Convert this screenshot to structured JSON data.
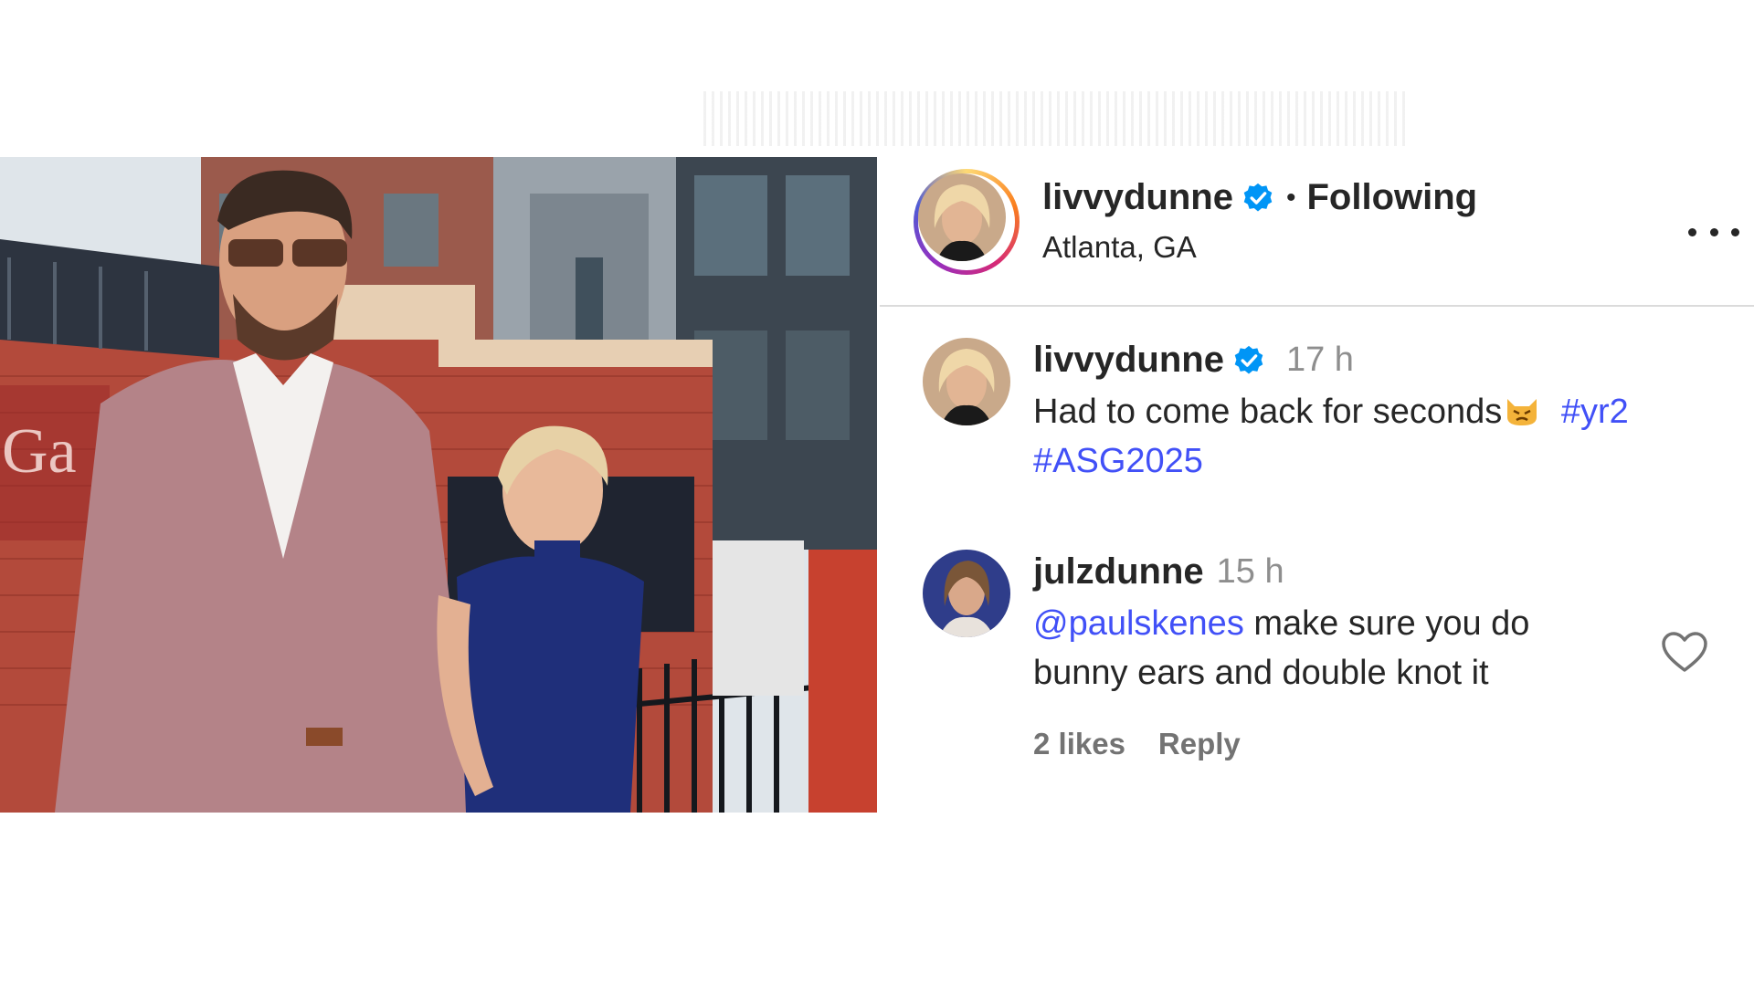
{
  "post": {
    "author": {
      "username": "livvydunne",
      "verified": true
    },
    "follow_status": "Following",
    "separator": "•",
    "location": "Atlanta, GA",
    "image_description_icon": "photo",
    "caption": {
      "username": "livvydunne",
      "time": "17 h",
      "text_before": "Had to come back for seconds",
      "emoji": "pouting-cat-emoji",
      "hashtags": [
        "#yr2",
        "#ASG2025"
      ]
    },
    "comments": [
      {
        "username": "julzdunne",
        "time": "15 h",
        "mention": "@paulskenes",
        "text": " make sure you do bunny ears and double knot it",
        "likes": "2 likes",
        "reply_label": "Reply"
      }
    ]
  },
  "colors": {
    "link": "#4150f7",
    "verified": "#0095f6",
    "muted": "#8e8e8e",
    "divider": "#dbdbdb"
  },
  "icons": [
    "verified-badge-icon",
    "more-options-icon",
    "heart-icon"
  ]
}
